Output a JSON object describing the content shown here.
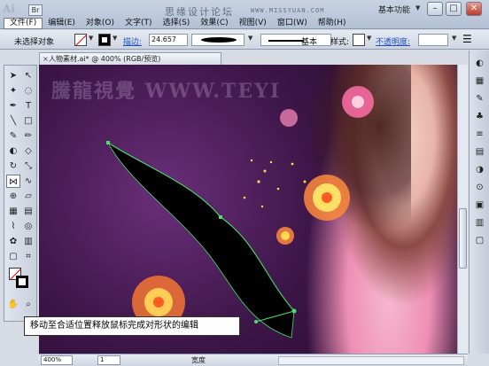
{
  "app": {
    "logo": "Ai",
    "bridge": "Br"
  },
  "title": {
    "forum": "思缘设计论坛",
    "url": "WWW.MISSYUAN.COM",
    "workspace": "基本功能"
  },
  "window_buttons": {
    "minimize": "–",
    "maximize": "□",
    "close": "✕"
  },
  "menu": [
    "文件(F)",
    "编辑(E)",
    "对象(O)",
    "文字(T)",
    "选择(S)",
    "效果(C)",
    "视图(V)",
    "窗口(W)",
    "帮助(H)"
  ],
  "control": {
    "selection": "未选择对象",
    "stroke_label": "描边:",
    "stroke_value": "24.657",
    "profile": "基本",
    "style_label": "样式:",
    "opacity_label": "不透明度:"
  },
  "document": {
    "tab": "人物素材.ai* @ 400% (RGB/预览)",
    "watermark": "騰龍視覺 WWW.TEYI"
  },
  "caption": "移动至合适位置释放鼠标完成对形状的编辑",
  "status": {
    "zoom": "400%",
    "page": "1",
    "label": "宽度"
  },
  "tools": [
    "arrow-icon",
    "direct-select-icon",
    "magic-wand-icon",
    "lasso-icon",
    "pen-icon",
    "type-icon",
    "line-icon",
    "rectangle-icon",
    "brush-icon",
    "pencil-icon",
    "blob-brush-icon",
    "eraser-icon",
    "rotate-icon",
    "scale-icon",
    "width-tool-icon",
    "warp-icon",
    "shape-builder-icon",
    "perspective-icon",
    "mesh-icon",
    "gradient-icon",
    "eyedropper-icon",
    "blend-icon",
    "symbol-sprayer-icon",
    "graph-icon",
    "artboard-icon",
    "slice-icon",
    "hand-icon",
    "zoom-icon"
  ],
  "colors": {
    "accent_link": "#1f4fc2",
    "path_highlight": "#46e06a",
    "shape_fill": "#000000"
  }
}
